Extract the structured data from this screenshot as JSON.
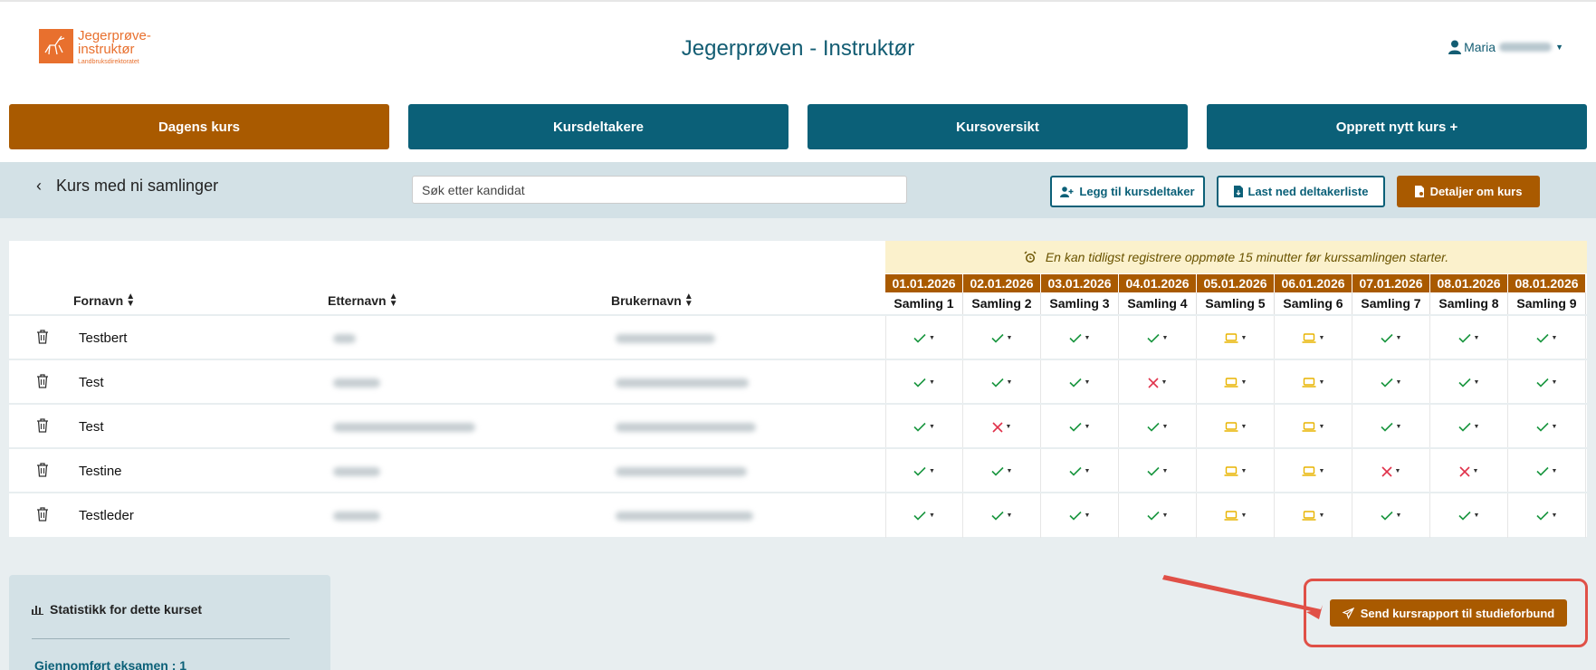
{
  "header": {
    "logo": {
      "line1": "Jegerprøve-",
      "line2": "instruktør",
      "sub": "Landbruksdirektoratet"
    },
    "title": "Jegerprøven - Instruktør",
    "user": "Maria"
  },
  "nav": [
    {
      "label": "Dagens kurs",
      "active": true
    },
    {
      "label": "Kursdeltakere"
    },
    {
      "label": "Kursoversikt"
    },
    {
      "label": "Opprett nytt kurs +"
    }
  ],
  "toolbar": {
    "back_label": "Kurs med ni samlinger",
    "search_placeholder": "Søk etter kandidat",
    "add_participant": "Legg til kursdeltaker",
    "download_list": "Last ned deltakerliste",
    "details": "Detaljer om kurs"
  },
  "notice": "En kan tidligst registrere oppmøte 15 minutter før kurssamlingen starter.",
  "columns": {
    "first": "Fornavn",
    "last": "Etternavn",
    "user": "Brukernavn"
  },
  "sessions": [
    {
      "date": "01.01.2026",
      "name": "Samling 1"
    },
    {
      "date": "02.01.2026",
      "name": "Samling 2"
    },
    {
      "date": "03.01.2026",
      "name": "Samling 3"
    },
    {
      "date": "04.01.2026",
      "name": "Samling 4"
    },
    {
      "date": "05.01.2026",
      "name": "Samling 5"
    },
    {
      "date": "06.01.2026",
      "name": "Samling 6"
    },
    {
      "date": "07.01.2026",
      "name": "Samling 7"
    },
    {
      "date": "08.01.2026",
      "name": "Samling 8"
    },
    {
      "date": "08.01.2026",
      "name": "Samling 9"
    }
  ],
  "participants": [
    {
      "first": "Testbert",
      "att": [
        "present",
        "present",
        "present",
        "present",
        "online",
        "online",
        "present",
        "present",
        "present"
      ]
    },
    {
      "first": "Test",
      "att": [
        "present",
        "present",
        "present",
        "absent",
        "online",
        "online",
        "present",
        "present",
        "present"
      ]
    },
    {
      "first": "Test",
      "att": [
        "present",
        "absent",
        "present",
        "present",
        "online",
        "online",
        "present",
        "present",
        "present"
      ]
    },
    {
      "first": "Testine",
      "att": [
        "present",
        "present",
        "present",
        "present",
        "online",
        "online",
        "absent",
        "absent",
        "present"
      ]
    },
    {
      "first": "Testleder",
      "att": [
        "present",
        "present",
        "present",
        "present",
        "online",
        "online",
        "present",
        "present",
        "present"
      ]
    }
  ],
  "stats": {
    "title": "Statistikk for dette kurset",
    "completed": "Gjennomført eksamen : 1"
  },
  "send_report": "Send kursrapport til studieforbund",
  "colors": {
    "brand_orange": "#a95a00",
    "brand_teal": "#0b6078",
    "present": "#1a9640",
    "absent": "#e0314a",
    "online": "#e8b400"
  }
}
